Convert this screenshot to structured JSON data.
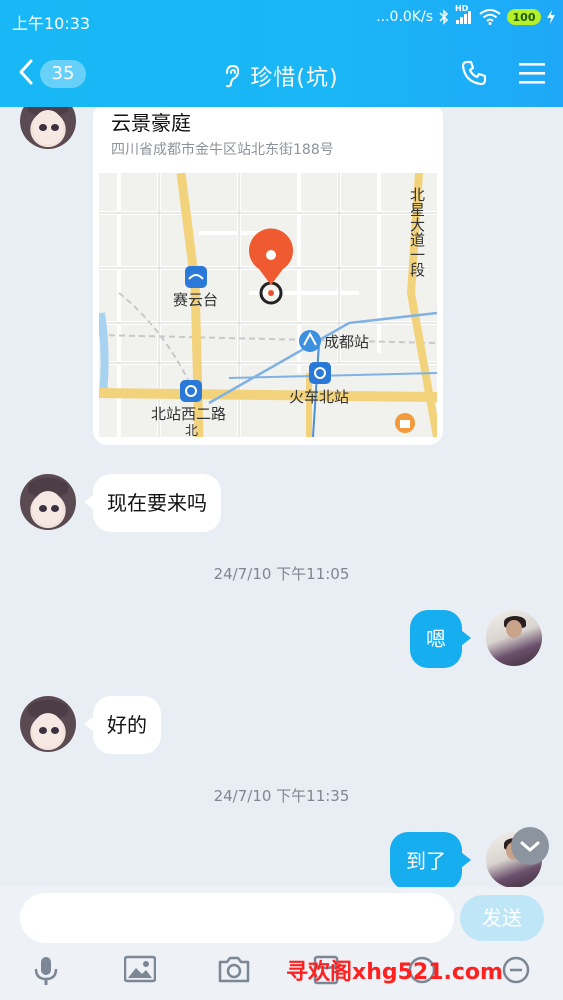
{
  "status_bar": {
    "time": "上午10:33",
    "network_speed": "...0.0K/s",
    "network_type": "HD",
    "battery": "100"
  },
  "header": {
    "back_count": "35",
    "title": "珍惜(坑)",
    "icons": [
      "back-chevron-icon",
      "ear-icon",
      "phone-icon",
      "menu-icon"
    ]
  },
  "messages": {
    "location": {
      "name": "云景豪庭",
      "address": "四川省成都市金牛区站北东街188号",
      "map_labels": {
        "saiyuntai": "赛云台",
        "chengdu_station": "成都站",
        "huoche_beizhan": "火车北站",
        "beizhan_xi_erlu": "北站西二路",
        "beixing_dadao": "北星大道一段",
        "bei": "北"
      }
    },
    "incoming_1": "现在要来吗",
    "time_1": "24/7/10 下午11:05",
    "outgoing_1": "嗯",
    "incoming_2": "好的",
    "time_2": "24/7/10 下午11:35",
    "outgoing_2": "到了"
  },
  "composer": {
    "placeholder": "",
    "send_label": "发送",
    "tools": [
      "microphone-icon",
      "image-icon",
      "camera-icon",
      "red-packet-icon",
      "emoji-icon",
      "more-icon"
    ]
  },
  "watermark": "寻欢阁xhg521.com",
  "colors": {
    "header": "#17b8f5",
    "outgoing_bubble": "#17aef0",
    "send_button": "#bfe6f7",
    "watermark": "#ff2020"
  }
}
